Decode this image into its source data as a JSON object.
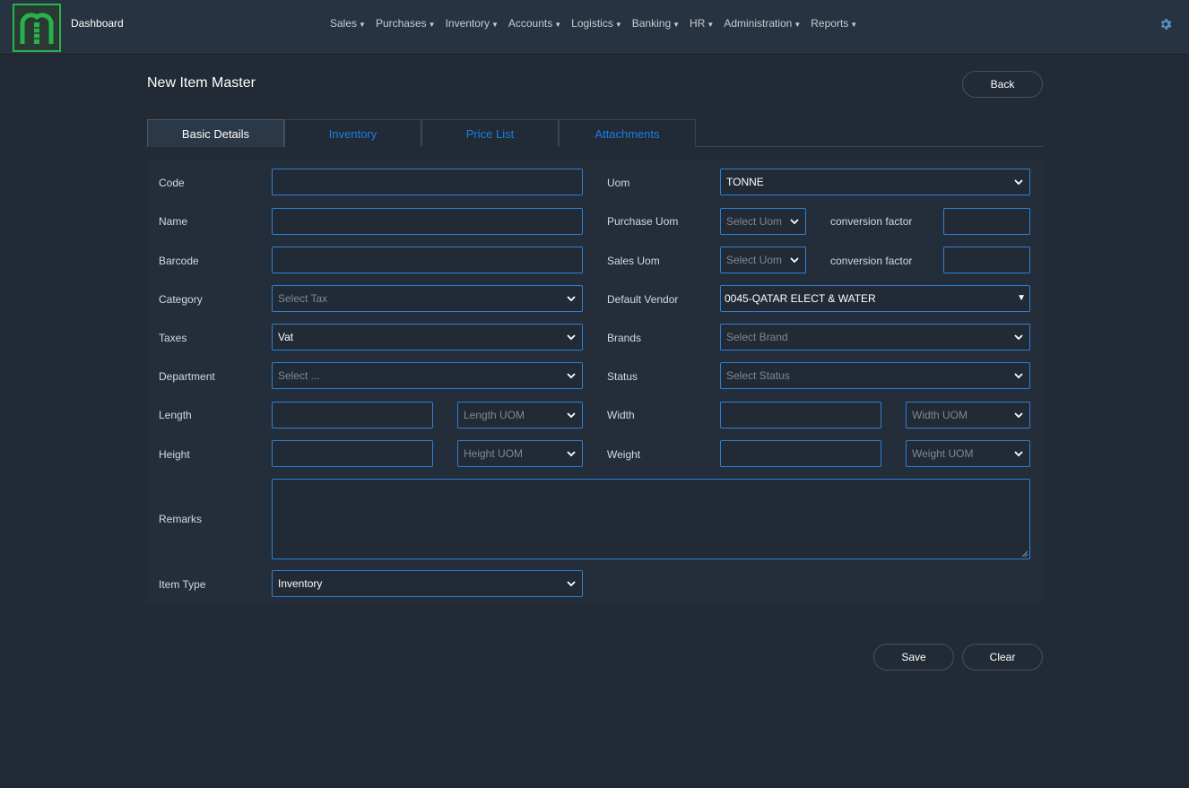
{
  "nav": {
    "brand": "Dashboard",
    "menu": [
      {
        "label": "Sales"
      },
      {
        "label": "Purchases"
      },
      {
        "label": "Inventory"
      },
      {
        "label": "Accounts"
      },
      {
        "label": "Logistics"
      },
      {
        "label": "Banking"
      },
      {
        "label": "HR"
      },
      {
        "label": "Administration"
      },
      {
        "label": "Reports"
      }
    ],
    "settings_icon": "gear-icon"
  },
  "page": {
    "title": "New Item Master",
    "back_label": "Back"
  },
  "tabs": [
    {
      "label": "Basic Details",
      "active": true
    },
    {
      "label": "Inventory",
      "active": false
    },
    {
      "label": "Price List",
      "active": false
    },
    {
      "label": "Attachments",
      "active": false
    }
  ],
  "form": {
    "code": {
      "label": "Code",
      "value": ""
    },
    "name": {
      "label": "Name",
      "value": ""
    },
    "barcode": {
      "label": "Barcode",
      "value": ""
    },
    "category": {
      "label": "Category",
      "placeholder": "Select Tax"
    },
    "taxes": {
      "label": "Taxes",
      "value": "Vat"
    },
    "department": {
      "label": "Department",
      "placeholder": "Select ..."
    },
    "length": {
      "label": "Length",
      "value": "",
      "uom_placeholder": "Length UOM"
    },
    "height": {
      "label": "Height",
      "value": "",
      "uom_placeholder": "Height UOM"
    },
    "remarks": {
      "label": "Remarks",
      "value": ""
    },
    "item_type": {
      "label": "Item Type",
      "value": "Inventory"
    },
    "uom": {
      "label": "Uom",
      "value": "TONNE"
    },
    "purchase_uom": {
      "label": "Purchase Uom",
      "placeholder": "Select Uom",
      "conversion_label": "conversion factor",
      "conversion_value": ""
    },
    "sales_uom": {
      "label": "Sales Uom",
      "placeholder": "Select Uom",
      "conversion_label": "conversion factor",
      "conversion_value": ""
    },
    "default_vendor": {
      "label": "Default Vendor",
      "value": "0045-QATAR ELECT & WATER"
    },
    "brands": {
      "label": "Brands",
      "placeholder": "Select Brand"
    },
    "status": {
      "label": "Status",
      "placeholder": "Select Status"
    },
    "width": {
      "label": "Width",
      "value": "",
      "uom_placeholder": "Width UOM"
    },
    "weight": {
      "label": "Weight",
      "value": "",
      "uom_placeholder": "Weight UOM"
    }
  },
  "actions": {
    "save_label": "Save",
    "clear_label": "Clear"
  },
  "colors": {
    "background": "#212a35",
    "navbar": "#273341",
    "accent_blue": "#2f7fd4",
    "tab_link": "#1a7fe6",
    "logo_green": "#27b14f"
  }
}
